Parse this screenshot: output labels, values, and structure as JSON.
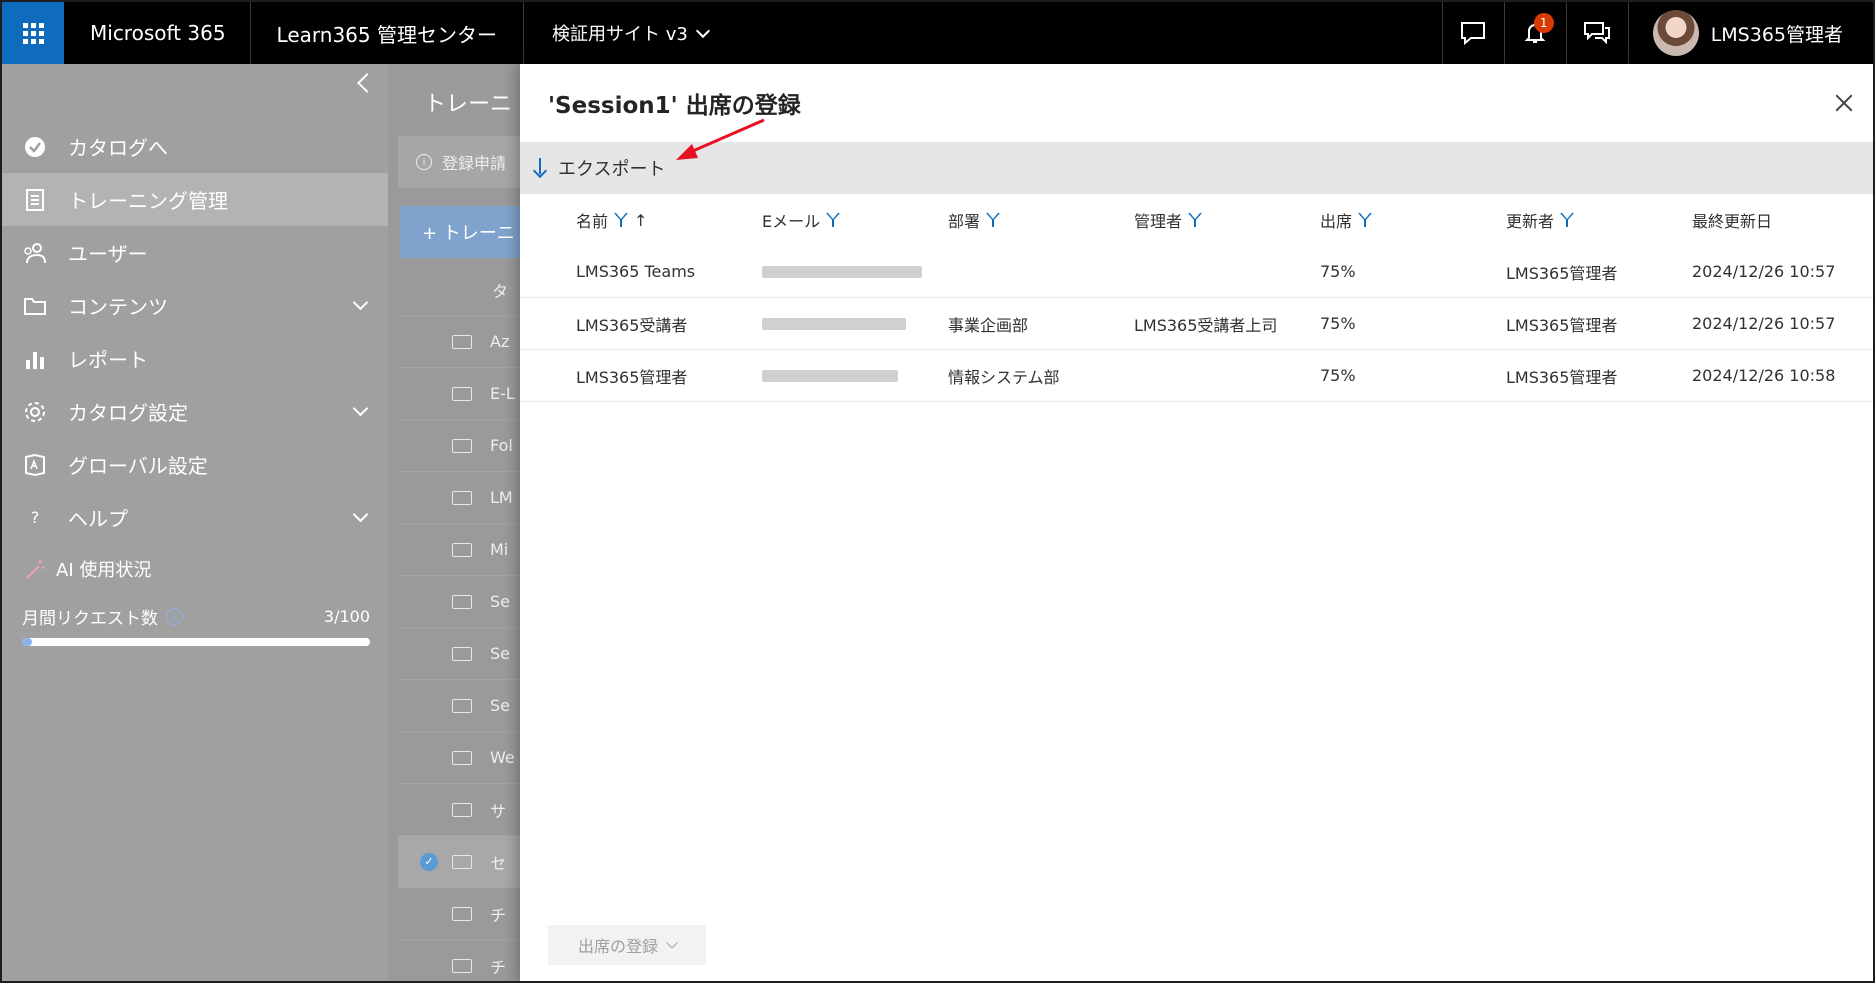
{
  "topbar": {
    "brand": "Microsoft 365",
    "product": "Learn365 管理センター",
    "site": "検証用サイト v3",
    "notification_count": "1",
    "user_name": "LMS365管理者"
  },
  "leftnav": {
    "items": [
      {
        "label": "カタログへ",
        "icon": "catalog-icon",
        "active": false,
        "expandable": false
      },
      {
        "label": "トレーニング管理",
        "icon": "training-icon",
        "active": true,
        "expandable": false
      },
      {
        "label": "ユーザー",
        "icon": "users-icon",
        "active": false,
        "expandable": false
      },
      {
        "label": "コンテンツ",
        "icon": "folder-icon",
        "active": false,
        "expandable": true
      },
      {
        "label": "レポート",
        "icon": "chart-icon",
        "active": false,
        "expandable": false
      },
      {
        "label": "カタログ設定",
        "icon": "gear-icon",
        "active": false,
        "expandable": true
      },
      {
        "label": "グローバル設定",
        "icon": "global-settings-icon",
        "active": false,
        "expandable": false
      },
      {
        "label": "ヘルプ",
        "icon": "help-icon",
        "active": false,
        "expandable": true
      }
    ],
    "ai_label": "AI 使用状況",
    "monthly_requests_label": "月間リクエスト数",
    "monthly_requests_count": "3/100",
    "monthly_requests_fraction": 0.03
  },
  "midpage": {
    "title": "トレーニ",
    "info": "登録申請",
    "add_button": "+ トレーニ",
    "rows": [
      "タ",
      "Az",
      "E-L",
      "Fol",
      "LM",
      "Mi",
      "Se",
      "Se",
      "Se",
      "We",
      "サ",
      "セ",
      "チ",
      "チ"
    ]
  },
  "panel": {
    "title": "'Session1' 出席の登録",
    "export_label": "エクスポート",
    "columns": [
      "名前",
      "Eメール",
      "部署",
      "管理者",
      "出席",
      "更新者",
      "最終更新日"
    ],
    "rows": [
      {
        "name": "LMS365 Teams",
        "dept": "",
        "manager": "",
        "attendance": "75%",
        "updated_by": "LMS365管理者",
        "updated": "2024/12/26 10:57"
      },
      {
        "name": "LMS365受講者",
        "dept": "事業企画部",
        "manager": "LMS365受講者上司",
        "attendance": "75%",
        "updated_by": "LMS365管理者",
        "updated": "2024/12/26 10:57"
      },
      {
        "name": "LMS365管理者",
        "dept": "情報システム部",
        "manager": "",
        "attendance": "75%",
        "updated_by": "LMS365管理者",
        "updated": "2024/12/26 10:58"
      }
    ],
    "footer_button": "出席の登録"
  },
  "colors": {
    "accent": "#0f6cbd",
    "annotation_arrow": "#e81123"
  }
}
